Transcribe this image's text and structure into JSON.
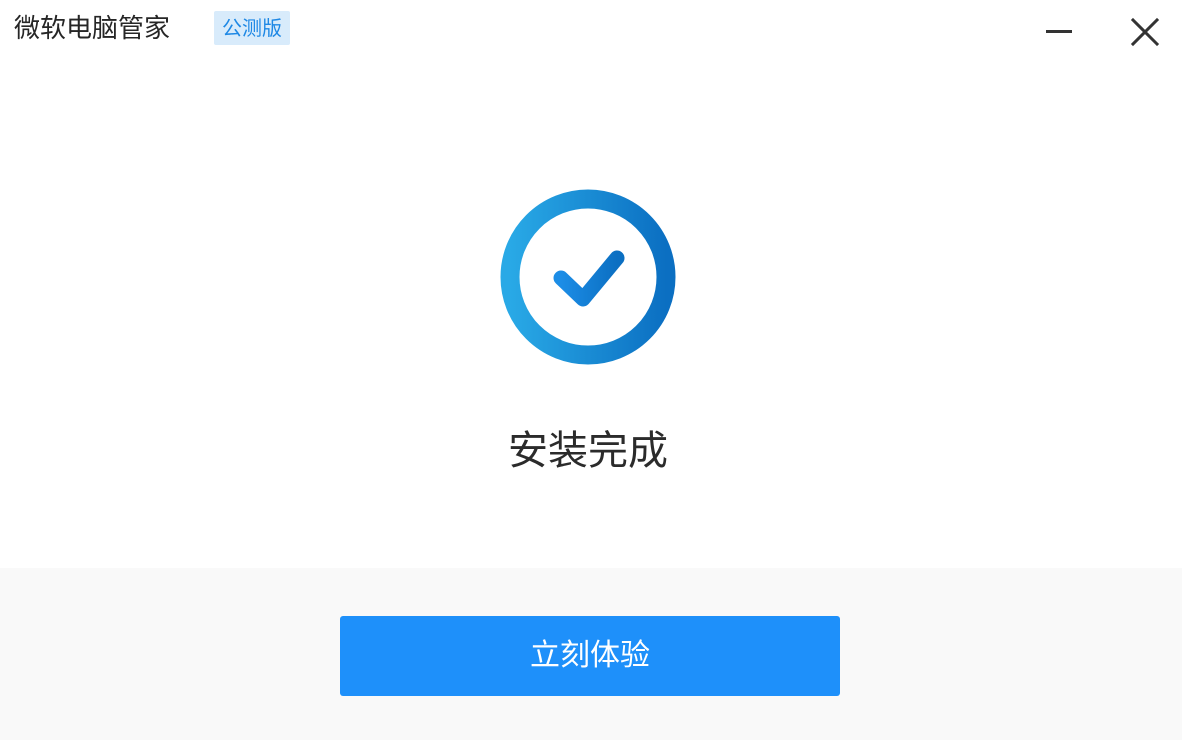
{
  "titlebar": {
    "app_name": "微软电脑管家",
    "badge": "公测版",
    "minimize_icon": "minimize-icon",
    "close_icon": "close-icon"
  },
  "main": {
    "status_icon": "check-circle-icon",
    "status_text": "安装完成"
  },
  "footer": {
    "primary_button_label": "立刻体验"
  },
  "colors": {
    "accent": "#1e90fa",
    "badge_bg": "#d8ebfb",
    "badge_text": "#1e88e5",
    "footer_bg": "#f9f9f9",
    "ring_gradient_start": "#29a9e6",
    "ring_gradient_end": "#0b6fc2"
  }
}
